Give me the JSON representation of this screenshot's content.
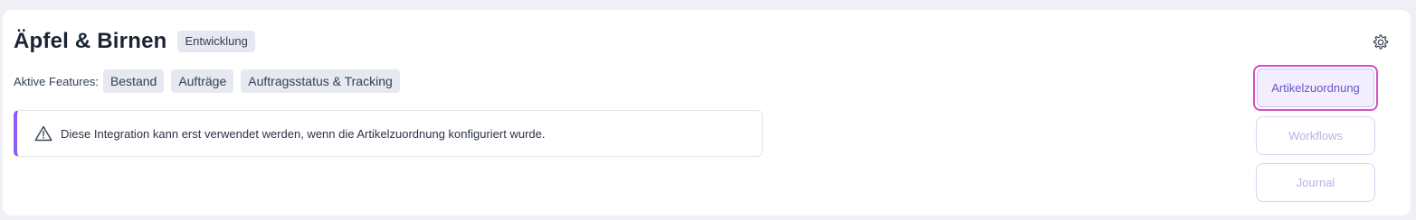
{
  "integration": {
    "title": "Äpfel & Birnen",
    "environment_badge": "Entwicklung",
    "features_label": "Aktive Features:",
    "features": [
      "Bestand",
      "Aufträge",
      "Auftragsstatus & Tracking"
    ]
  },
  "alert": {
    "icon": "warning-triangle-icon",
    "text": "Diese Integration kann erst verwendet werden, wenn die Artikelzuordnung konfiguriert wurde.",
    "accent_color": "#8b5cf6"
  },
  "actions": {
    "settings_icon": "gear-icon",
    "article_mapping_label": "Artikelzuordnung",
    "workflows_label": "Workflows",
    "journal_label": "Journal"
  }
}
